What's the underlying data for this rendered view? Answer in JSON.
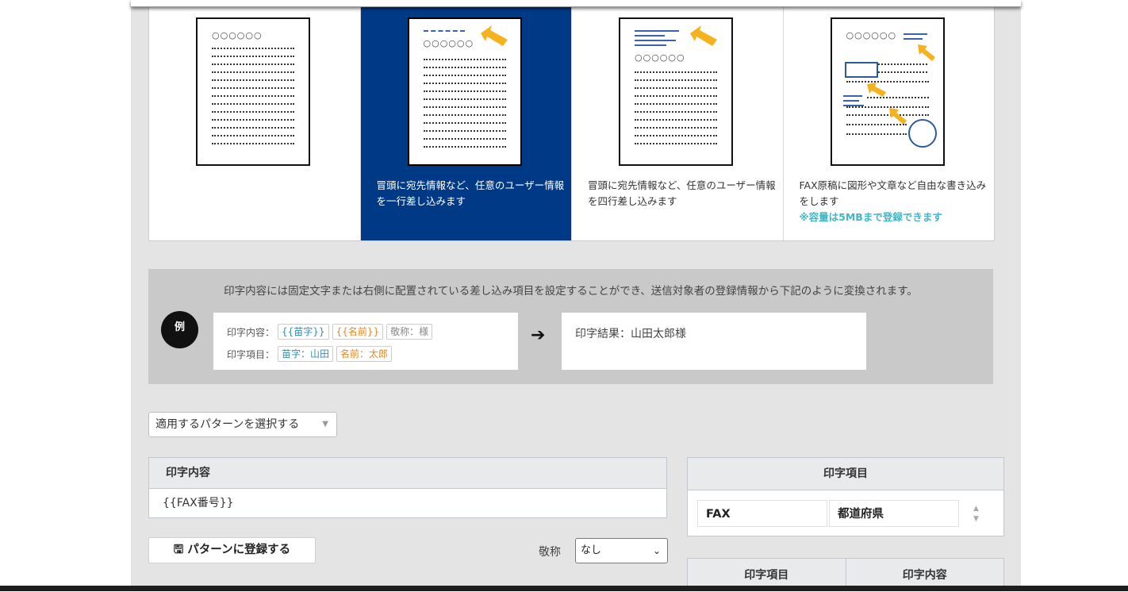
{
  "cards": [
    {
      "desc": "",
      "note": ""
    },
    {
      "desc": "冒頭に宛先情報など、任意のユーザー情報を一行差し込みます",
      "note": ""
    },
    {
      "desc": "冒頭に宛先情報など、任意のユーザー情報を四行差し込みます",
      "note": ""
    },
    {
      "desc": "FAX原稿に図形や文章など自由な書き込みをします",
      "note": "※容量は5MBまで登録できます"
    }
  ],
  "doc_placeholder": "○○○○○○",
  "info": {
    "lead": "印字内容には固定文字または右側に配置されている差し込み項目を設定することができ、送信対象者の登録情報から下記のように変換されます。",
    "example_badge": "例",
    "content_label": "印字内容：",
    "content_tags": [
      "{{苗字}}",
      "{{名前}}",
      "敬称：様"
    ],
    "items_label": "印字項目：",
    "item_tags": [
      "苗字：山田",
      "名前：太郎"
    ],
    "arrow": "➔",
    "result": "印字結果：山田太郎様"
  },
  "pattern_select": {
    "value": "適用するパターンを選択する",
    "caret": "▼"
  },
  "content": {
    "header": "印字内容",
    "value": "{{FAX番号}}"
  },
  "register_button": "🖫 パターンに登録する",
  "keisho": {
    "label": "敬称",
    "value": "なし",
    "chevron": "⌄"
  },
  "items_panel": {
    "header": "印字項目",
    "chips": [
      "FAX",
      "都道府県"
    ]
  },
  "mapping_table": {
    "headers": [
      "印字項目",
      "印字内容"
    ]
  }
}
